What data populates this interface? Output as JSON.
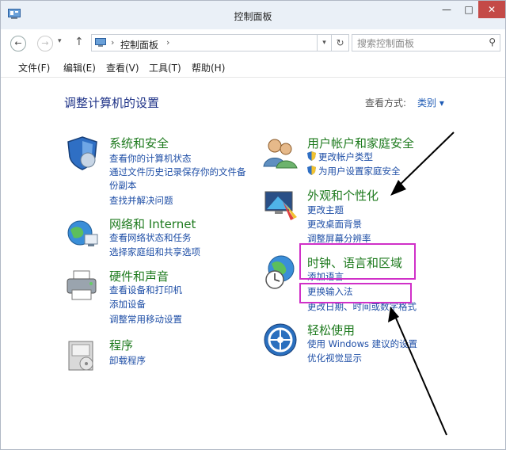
{
  "window": {
    "title": "控制面板",
    "minimize": "—",
    "maximize": "□",
    "close": "✕"
  },
  "address": {
    "path": "控制面板",
    "search_placeholder": "搜索控制面板"
  },
  "menu": [
    "文件(F)",
    "编辑(E)",
    "查看(V)",
    "工具(T)",
    "帮助(H)"
  ],
  "page": {
    "heading": "调整计算机的设置",
    "view_by_label": "查看方式:",
    "view_by_value": "类别 ▾"
  },
  "categories": {
    "system": {
      "title": "系统和安全",
      "links": [
        "查看你的计算机状态",
        "通过文件历史记录保存你的文件备",
        "份副本",
        "查找并解决问题"
      ]
    },
    "network": {
      "title": "网络和 Internet",
      "links": [
        "查看网络状态和任务",
        "选择家庭组和共享选项"
      ]
    },
    "hardware": {
      "title": "硬件和声音",
      "links": [
        "查看设备和打印机",
        "添加设备",
        "调整常用移动设置"
      ]
    },
    "programs": {
      "title": "程序",
      "links": [
        "卸载程序"
      ]
    },
    "users": {
      "title": "用户帐户和家庭安全",
      "links": [
        "更改帐户类型",
        "为用户设置家庭安全"
      ]
    },
    "appearance": {
      "title": "外观和个性化",
      "links": [
        "更改主题",
        "更改桌面背景",
        "调整屏幕分辨率"
      ]
    },
    "clock": {
      "title": "时钟、语言和区域",
      "links": [
        "添加语言",
        "更换输入法",
        "更改日期、时间或数字格式"
      ]
    },
    "ease": {
      "title": "轻松使用",
      "links": [
        "使用 Windows 建议的设置",
        "优化视觉显示"
      ]
    }
  },
  "colors": {
    "highlight": "#d030c8",
    "link": "#1e4ea6",
    "category_title": "#1d7a1d",
    "heading": "#1e3287"
  }
}
